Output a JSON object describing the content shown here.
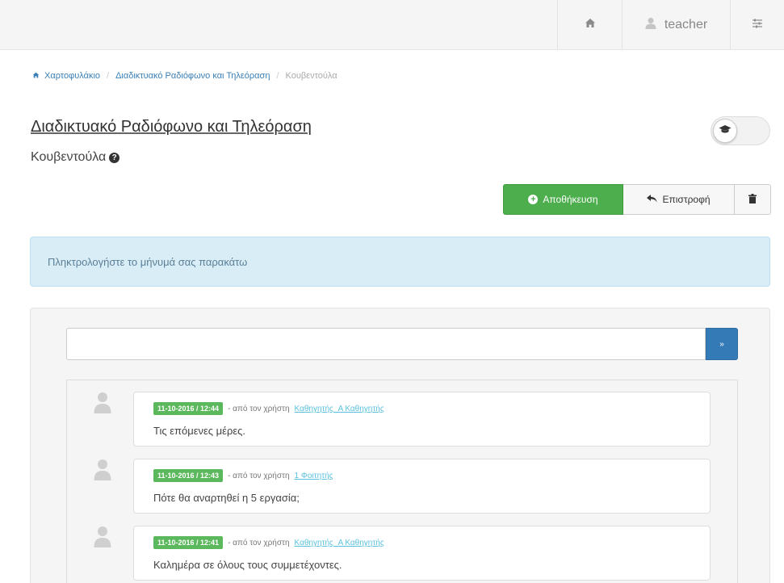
{
  "navbar": {
    "home_icon": "home-icon",
    "user_icon": "user-icon",
    "username": "teacher",
    "settings_icon": "sliders-icon"
  },
  "breadcrumb": {
    "items": [
      "Χαρτοφυλάκιο",
      "Διαδικτυακό Ραδιόφωνο και Τηλεόραση",
      "Κουβεντούλα"
    ],
    "separator": "/"
  },
  "page": {
    "course_title": "Διαδικτυακό Ραδιόφωνο και Τηλεόραση",
    "subtitle": "Κουβεντούλα",
    "help_icon": "?"
  },
  "toolbar": {
    "save_label": "Αποθήκευση",
    "back_label": "Επιστροφή",
    "delete_icon": "trash-icon"
  },
  "alert": {
    "text": "Πληκτρολογήστε το μήνυμά σας παρακάτω"
  },
  "chat": {
    "input_value": "",
    "send_label": "»",
    "by_user_prefix": "- από τον χρήστη",
    "messages": [
      {
        "timestamp": "11-10-2016 / 12:44",
        "user": "Καθηγητής_Α Καθηγητής",
        "text": "Τις επόμενες μέρες."
      },
      {
        "timestamp": "11-10-2016 / 12:43",
        "user": "1 Φοιτητής",
        "text": "Πότε θα αναρτηθεί η 5 εργασία;"
      },
      {
        "timestamp": "11-10-2016 / 12:41",
        "user": "Καθηγητής_Α Καθηγητής",
        "text": "Καλημέρα σε όλους τους συμμετέχοντες."
      }
    ]
  },
  "colors": {
    "success": "#4cae4c",
    "primary": "#337ab7",
    "info_bg": "#d9edf7",
    "link": "#3a7fb5",
    "user_link": "#5bc0de"
  }
}
